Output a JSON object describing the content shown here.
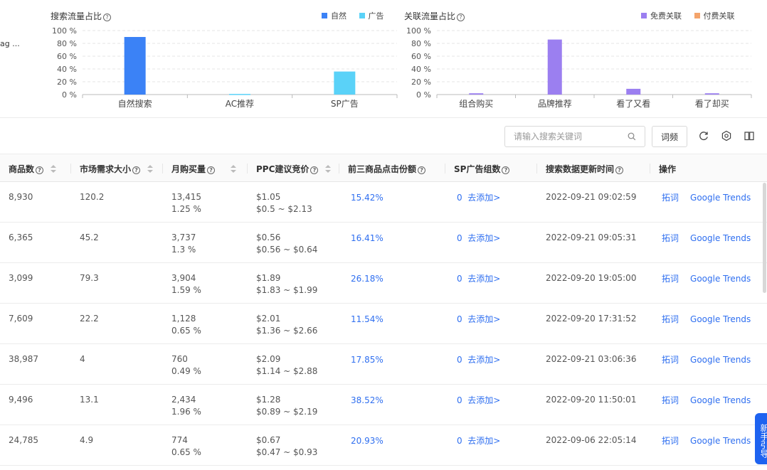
{
  "left_clip_text": "ag ...",
  "search_chart": {
    "title": "搜索流量占比",
    "legend": [
      {
        "name": "自然",
        "color": "#3b82f6"
      },
      {
        "name": "广告",
        "color": "#5ad2f8"
      }
    ],
    "chart_data": {
      "type": "bar",
      "categories": [
        "自然搜索",
        "AC推荐",
        "SP广告"
      ],
      "series": [
        {
          "name": "",
          "values": [
            90,
            1,
            36
          ],
          "colors": [
            "#3b82f6",
            "#5ad2f8",
            "#5ad2f8"
          ]
        }
      ],
      "ylim": [
        0,
        100
      ],
      "yticks": [
        "0 %",
        "20 %",
        "40 %",
        "60 %",
        "80 %",
        "100 %"
      ]
    }
  },
  "assoc_chart": {
    "title": "关联流量占比",
    "legend": [
      {
        "name": "免费关联",
        "color": "#9b7ff0"
      },
      {
        "name": "付费关联",
        "color": "#f4a46b"
      }
    ],
    "chart_data": {
      "type": "bar",
      "categories": [
        "组合购买",
        "品牌推荐",
        "看了又看",
        "看了却买"
      ],
      "series": [
        {
          "name": "",
          "values": [
            2,
            86,
            9,
            2
          ],
          "colors": [
            "#9b7ff0",
            "#9b7ff0",
            "#9b7ff0",
            "#9b7ff0"
          ]
        }
      ],
      "ylim": [
        0,
        100
      ],
      "yticks": [
        "0 %",
        "20 %",
        "40 %",
        "60 %",
        "80 %",
        "100 %"
      ]
    }
  },
  "toolbar": {
    "search_placeholder": "请输入搜索关键词",
    "ciyan_label": "词频"
  },
  "table": {
    "headers": {
      "products": "商品数",
      "demand": "市场需求大小",
      "monthly": "月购买量",
      "ppc": "PPC建议竞价",
      "top3": "前三商品点击份额",
      "sp_groups": "SP广告组数",
      "updated": "搜索数据更新时间",
      "ops": "操作"
    },
    "rows": [
      {
        "products": "8,930",
        "demand": "120.2",
        "monthly": "13,415",
        "monthly_pct": "1.25 %",
        "ppc": "$1.05",
        "ppc_range": "$0.5 ~ $2.13",
        "top3": "15.42%",
        "sp_count": "0",
        "sp_add": "去添加>",
        "updated": "2022-09-21 09:02:59",
        "op1": "拓词",
        "op2": "Google Trends"
      },
      {
        "products": "6,365",
        "demand": "45.2",
        "monthly": "3,737",
        "monthly_pct": "1.3 %",
        "ppc": "$0.56",
        "ppc_range": "$0.56 ~ $0.64",
        "top3": "16.41%",
        "sp_count": "0",
        "sp_add": "去添加>",
        "updated": "2022-09-21 09:05:31",
        "op1": "拓词",
        "op2": "Google Trends"
      },
      {
        "products": "3,099",
        "demand": "79.3",
        "monthly": "3,904",
        "monthly_pct": "1.59 %",
        "ppc": "$1.89",
        "ppc_range": "$1.83 ~ $1.99",
        "top3": "26.18%",
        "sp_count": "0",
        "sp_add": "去添加>",
        "updated": "2022-09-20 19:05:00",
        "op1": "拓词",
        "op2": "Google Trends"
      },
      {
        "products": "7,609",
        "demand": "22.2",
        "monthly": "1,128",
        "monthly_pct": "0.65 %",
        "ppc": "$2.01",
        "ppc_range": "$1.36 ~ $2.66",
        "top3": "11.54%",
        "sp_count": "0",
        "sp_add": "去添加>",
        "updated": "2022-09-20 17:31:52",
        "op1": "拓词",
        "op2": "Google Trends"
      },
      {
        "products": "38,987",
        "demand": "4",
        "monthly": "760",
        "monthly_pct": "0.49 %",
        "ppc": "$2.09",
        "ppc_range": "$1.14 ~ $2.88",
        "top3": "17.85%",
        "sp_count": "0",
        "sp_add": "去添加>",
        "updated": "2022-09-21 03:06:36",
        "op1": "拓词",
        "op2": "Google Trends"
      },
      {
        "products": "9,496",
        "demand": "13.1",
        "monthly": "2,434",
        "monthly_pct": "1.96 %",
        "ppc": "$1.28",
        "ppc_range": "$0.89 ~ $2.19",
        "top3": "38.52%",
        "sp_count": "0",
        "sp_add": "去添加>",
        "updated": "2022-09-20 11:50:01",
        "op1": "拓词",
        "op2": "Google Trends"
      },
      {
        "products": "24,785",
        "demand": "4.9",
        "monthly": "774",
        "monthly_pct": "0.65 %",
        "ppc": "$0.67",
        "ppc_range": "$0.47 ~ $0.93",
        "top3": "20.93%",
        "sp_count": "0",
        "sp_add": "去添加>",
        "updated": "2022-09-06 22:05:14",
        "op1": "拓词",
        "op2": "Google Trends"
      }
    ]
  },
  "float_tab": "新手引导"
}
